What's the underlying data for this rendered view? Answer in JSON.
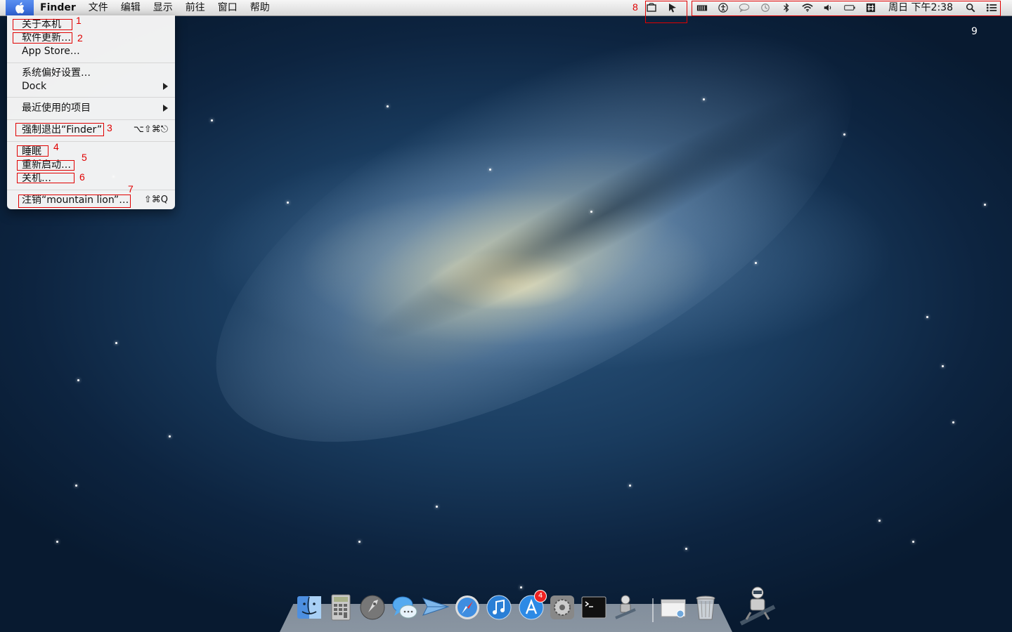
{
  "menubar": {
    "app_name": "Finder",
    "menus": [
      "文件",
      "编辑",
      "显示",
      "前往",
      "窗口",
      "帮助"
    ],
    "clock": "周日 下午2:38",
    "status_icons": [
      "notes-icon",
      "cursor-icon",
      "battery-level-icon",
      "accessibility-icon",
      "speech-bubble-icon",
      "time-machine-icon",
      "bluetooth-icon",
      "wifi-icon",
      "volume-icon",
      "battery-icon",
      "input-method-icon",
      "spotlight-icon",
      "notification-center-icon"
    ]
  },
  "apple_menu": {
    "items": [
      {
        "label": "关于本机",
        "annot": "1"
      },
      {
        "label": "软件更新…",
        "annot": "2"
      },
      {
        "label": "App Store…"
      },
      {
        "label": "系统偏好设置…"
      },
      {
        "label": "Dock"
      },
      {
        "label": "最近使用的项目"
      },
      {
        "label": "强制退出“Finder”",
        "shortcut": "⌥⇧⌘⎋",
        "annot": "3"
      },
      {
        "label": "睡眠",
        "annot": "4"
      },
      {
        "label": "重新启动…",
        "annot": "5"
      },
      {
        "label": "关机…",
        "annot": "6"
      },
      {
        "label": "注销“mountain lion”…",
        "shortcut": "⇧⌘Q",
        "annot": "7"
      }
    ]
  },
  "annotations": {
    "a8": "8",
    "a9": "9"
  },
  "dock": {
    "items": [
      "finder-icon",
      "calculator-icon",
      "launchpad-icon",
      "messages-icon",
      "mail-icon",
      "safari-icon",
      "itunes-icon",
      "app-store-icon",
      "system-preferences-icon",
      "terminal-icon",
      "automator-icon",
      "preview-icon",
      "trash-icon"
    ],
    "app_store_badge": "4"
  }
}
